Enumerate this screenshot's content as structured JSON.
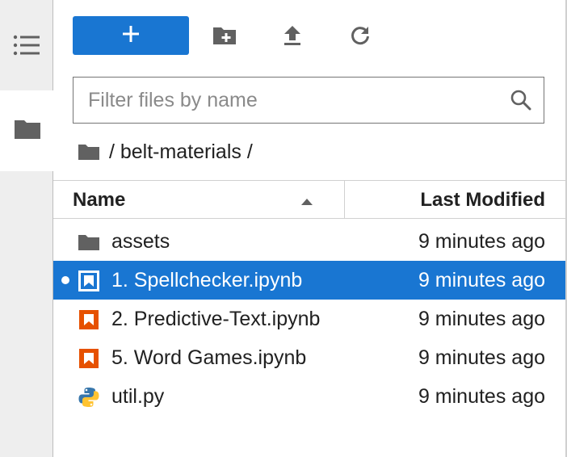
{
  "sidebar": {
    "items": [
      {
        "name": "table-of-contents",
        "icon": "list-icon"
      },
      {
        "name": "file-browser",
        "icon": "folder-icon",
        "active": true
      }
    ]
  },
  "toolbar": {
    "new_label": "+",
    "new_folder_icon": "new-folder-icon",
    "upload_icon": "upload-icon",
    "refresh_icon": "refresh-icon",
    "accent": "#1976d2"
  },
  "filter": {
    "placeholder": "Filter files by name",
    "value": ""
  },
  "breadcrumb": {
    "separator_start": " / ",
    "folder": "belt-materials",
    "separator_end": " /"
  },
  "columns": {
    "name": "Name",
    "modified": "Last Modified"
  },
  "files": [
    {
      "name": "assets",
      "modified": "9 minutes ago",
      "type": "folder",
      "selected": false,
      "running": false
    },
    {
      "name": "1. Spellchecker.ipynb",
      "modified": "9 minutes ago",
      "type": "notebook",
      "selected": true,
      "running": true
    },
    {
      "name": "2. Predictive-Text.ipynb",
      "modified": "9 minutes ago",
      "type": "notebook",
      "selected": false,
      "running": false
    },
    {
      "name": "5. Word Games.ipynb",
      "modified": "9 minutes ago",
      "type": "notebook",
      "selected": false,
      "running": false
    },
    {
      "name": "util.py",
      "modified": "9 minutes ago",
      "type": "python",
      "selected": false,
      "running": false
    }
  ]
}
